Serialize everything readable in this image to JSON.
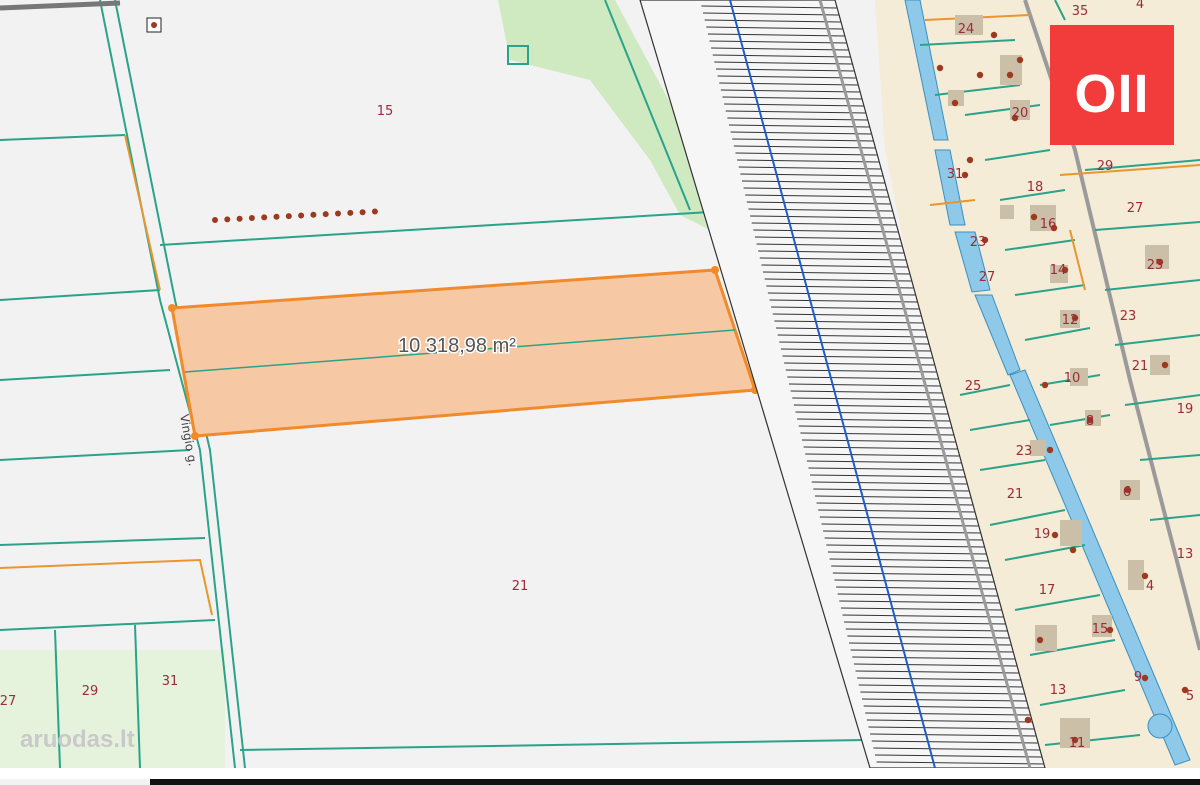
{
  "map": {
    "selected_parcel": {
      "area_label": "10 318,98 m²",
      "fill": "#f6c9a4",
      "stroke": "#f08a2a"
    },
    "street_label": "Vingio g.",
    "colors": {
      "parcel_line": "#2aa38a",
      "boundary_orange": "#e8962e",
      "green_area": "#cfe9c0",
      "light_green_area": "#e2f2d6",
      "residential_fill": "#f4ecd6",
      "building": "#cbbfa8",
      "road": "#9a9a9a",
      "water": "#8ec9ea",
      "rail_line": "#1f5cc7",
      "rail_ties": "#333333"
    },
    "plot_numbers": {
      "left_15": "15",
      "left_21": "21",
      "bl_27": "27",
      "bl_29": "29",
      "bl_31": "31",
      "r_35": "35",
      "r_4": "4",
      "r_24": "24",
      "r_20": "20",
      "r_31": "31",
      "r_29": "29",
      "r_18": "18",
      "r_16": "16",
      "r_27a": "27",
      "r_23a": "23",
      "r_27b": "27",
      "r_14": "14",
      "r_25a": "25",
      "r_12": "12",
      "r_23b": "23",
      "r_25b": "25",
      "r_10": "10",
      "r_21a": "21",
      "r_8": "8",
      "r_19a": "19",
      "r_23c": "23",
      "r_21b": "21",
      "r_6": "6",
      "r_19b": "19",
      "r_13a": "13",
      "r_17": "17",
      "r_4b": "4",
      "r_15": "15",
      "r_13b": "13",
      "r_9": "9",
      "r_11": "11",
      "r_5": "5"
    },
    "logo": {
      "text": "OII",
      "color": "#f23b3b"
    },
    "watermark": "aruodas.lt"
  }
}
